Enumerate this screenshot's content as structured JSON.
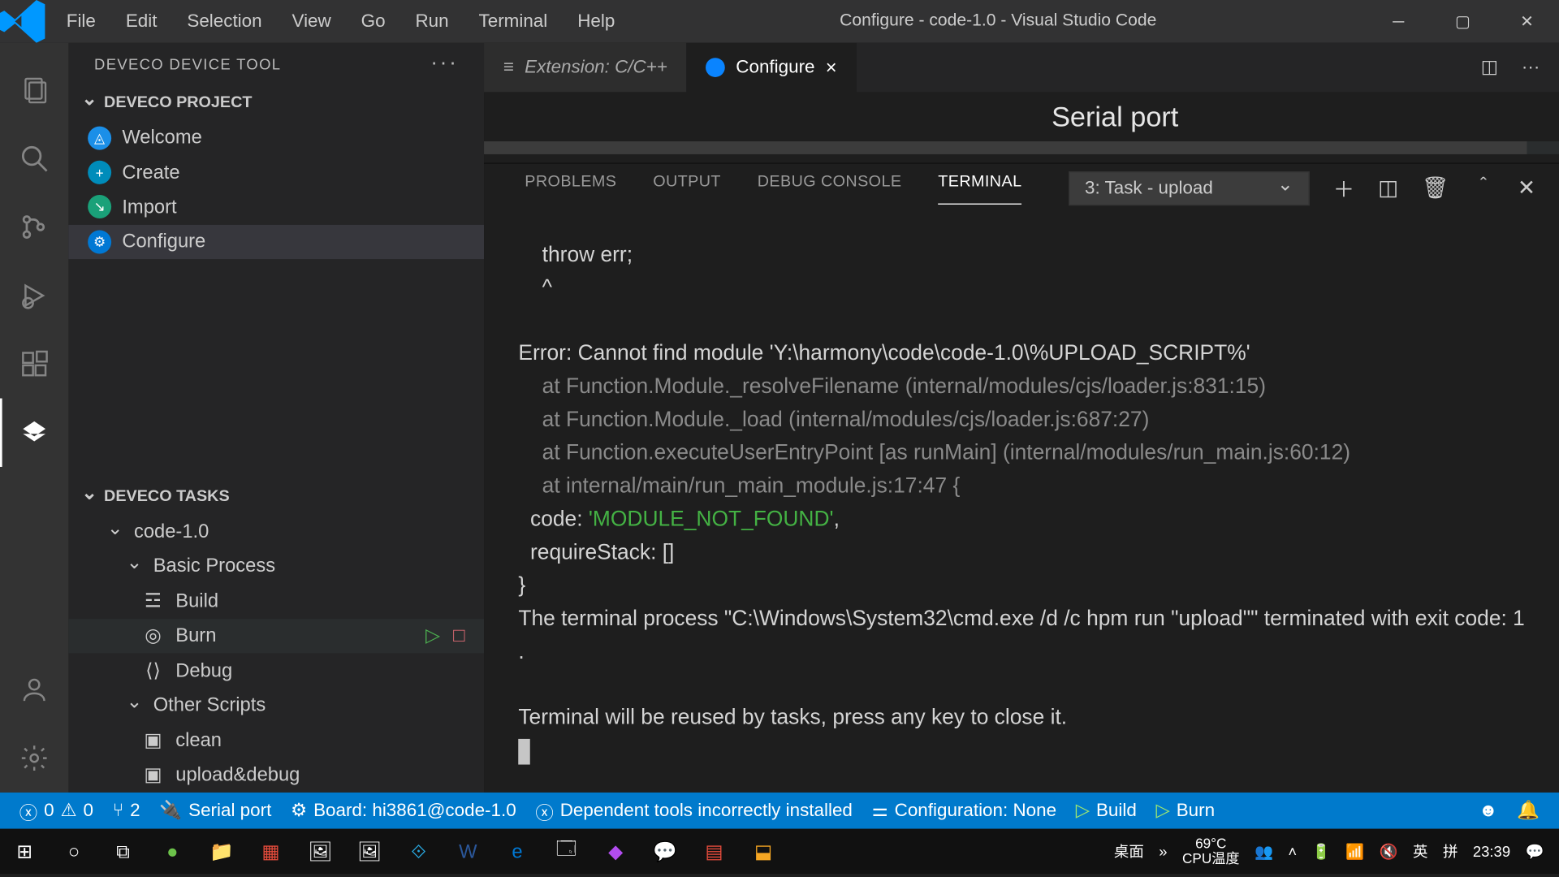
{
  "title": "Configure - code-1.0 - Visual Studio Code",
  "menu": [
    "File",
    "Edit",
    "Selection",
    "View",
    "Go",
    "Run",
    "Terminal",
    "Help"
  ],
  "side": {
    "header": "DEVECO DEVICE TOOL",
    "projectHeader": "DEVECO PROJECT",
    "items": [
      {
        "label": "Welcome",
        "color": "blue"
      },
      {
        "label": "Create",
        "color": "cyan"
      },
      {
        "label": "Import",
        "color": "teal"
      },
      {
        "label": "Configure",
        "color": "blue2"
      }
    ],
    "tasksHeader": "DEVECO TASKS",
    "project": "code-1.0",
    "basicHeader": "Basic Process",
    "basic": [
      "Build",
      "Burn",
      "Debug"
    ],
    "otherHeader": "Other Scripts",
    "other": [
      "clean",
      "upload&debug"
    ]
  },
  "tabs": {
    "inactive": "Extension: C/C++",
    "active": "Configure"
  },
  "serialHeading": "Serial port",
  "panelTabs": [
    "PROBLEMS",
    "OUTPUT",
    "DEBUG CONSOLE",
    "TERMINAL"
  ],
  "termSelector": "3: Task - upload",
  "terminal": {
    "l1": "    throw err;",
    "l2": "    ^",
    "errPrefix": "Error",
    "errMsg": ": Cannot find module 'Y:\\harmony\\code\\code-1.0\\%UPLOAD_SCRIPT%'",
    "s1": "    at Function.Module._resolveFilename (internal/modules/cjs/loader.js:831:15)",
    "s2": "    at Function.Module._load (internal/modules/cjs/loader.js:687:27)",
    "s3": "    at Function.executeUserEntryPoint [as runMain] (internal/modules/run_main.js:60:12)",
    "s4": "    at internal/main/run_main_module.js:17:47 {",
    "codeKey": "  code: ",
    "codeVal": "'MODULE_NOT_FOUND'",
    "codeComma": ",",
    "req": "  requireStack: []",
    "brace": "}",
    "exit": "The terminal process \"C:\\Windows\\System32\\cmd.exe /d /c hpm run \"upload\"\" terminated with exit code: 1\n.",
    "reuse": "Terminal will be reused by tasks, press any key to close it."
  },
  "status": {
    "errors": "0",
    "warnings": "0",
    "fork": "2",
    "serial": "Serial port",
    "board": "Board: hi3861@code-1.0",
    "dep": "Dependent tools incorrectly installed",
    "conf": "Configuration: None",
    "build": "Build",
    "burn": "Burn"
  },
  "tray": {
    "desk": "桌面",
    "temp": "69°C",
    "tempLabel": "CPU温度",
    "ime": "英",
    "ime2": "拼",
    "time": "23:39"
  }
}
